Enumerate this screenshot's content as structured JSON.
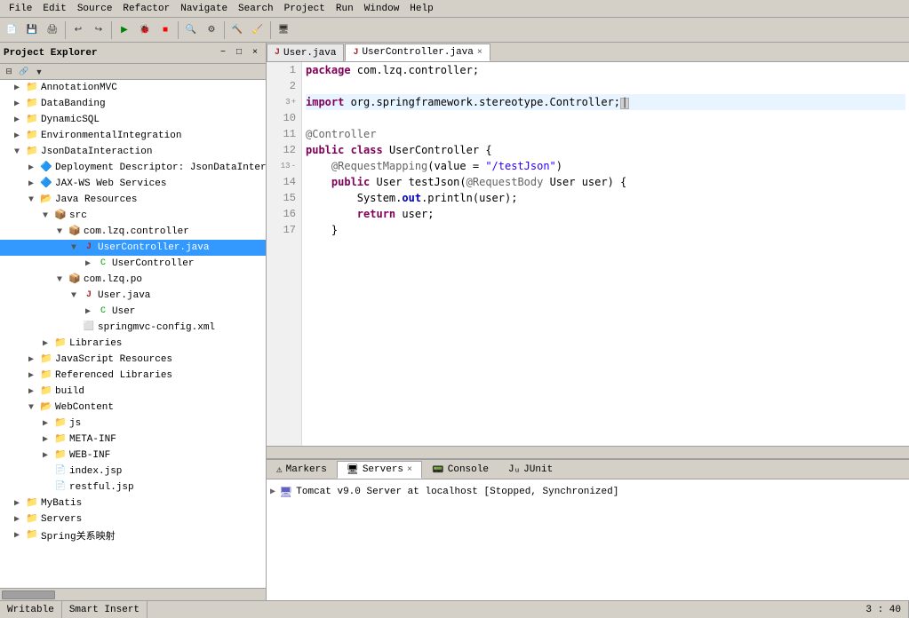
{
  "menubar": {
    "items": [
      "File",
      "Edit",
      "Source",
      "Refactor",
      "Navigate",
      "Search",
      "Project",
      "Run",
      "Window",
      "Help"
    ]
  },
  "panels": {
    "left": {
      "title": "Project Explorer",
      "close_icon": "×",
      "tree": [
        {
          "id": "annotationmvc",
          "label": "AnnotationMVC",
          "level": 0,
          "type": "project",
          "expanded": false,
          "icon": "📁"
        },
        {
          "id": "databanding",
          "label": "DataBanding",
          "level": 0,
          "type": "project",
          "expanded": false,
          "icon": "📁"
        },
        {
          "id": "dynamicsql",
          "label": "DynamicSQL",
          "level": 0,
          "type": "project",
          "expanded": false,
          "icon": "📁"
        },
        {
          "id": "environmentalintegration",
          "label": "EnvironmentalIntegration",
          "level": 0,
          "type": "project",
          "expanded": false,
          "icon": "📁"
        },
        {
          "id": "jsondatainteraction",
          "label": "JsonDataInteraction",
          "level": 0,
          "type": "project",
          "expanded": true,
          "icon": "📁"
        },
        {
          "id": "deployment",
          "label": "Deployment Descriptor: JsonDataIntera...",
          "level": 1,
          "type": "deploy",
          "expanded": false,
          "icon": "🔷"
        },
        {
          "id": "jaxws",
          "label": "JAX-WS Web Services",
          "level": 1,
          "type": "service",
          "expanded": false,
          "icon": "🔷"
        },
        {
          "id": "javaresources",
          "label": "Java Resources",
          "level": 1,
          "type": "folder",
          "expanded": true,
          "icon": "📂"
        },
        {
          "id": "src",
          "label": "src",
          "level": 2,
          "type": "src",
          "expanded": true,
          "icon": "📦"
        },
        {
          "id": "comlzqcontroller",
          "label": "com.lzq.controller",
          "level": 3,
          "type": "package",
          "expanded": true,
          "icon": "📦"
        },
        {
          "id": "usercontroller_java",
          "label": "UserController.java",
          "level": 4,
          "type": "java",
          "expanded": true,
          "icon": "J",
          "selected": true
        },
        {
          "id": "usercontroller_class",
          "label": "UserController",
          "level": 5,
          "type": "class",
          "expanded": false,
          "icon": "C"
        },
        {
          "id": "comlzqpo",
          "label": "com.lzq.po",
          "level": 3,
          "type": "package",
          "expanded": true,
          "icon": "📦"
        },
        {
          "id": "user_java",
          "label": "User.java",
          "level": 4,
          "type": "java",
          "expanded": true,
          "icon": "J"
        },
        {
          "id": "user_class",
          "label": "User",
          "level": 5,
          "type": "class",
          "expanded": false,
          "icon": "C"
        },
        {
          "id": "springmvc_config",
          "label": "springmvc-config.xml",
          "level": 3,
          "type": "xml",
          "icon": "X"
        },
        {
          "id": "libraries",
          "label": "Libraries",
          "level": 2,
          "type": "folder",
          "expanded": false,
          "icon": "📁"
        },
        {
          "id": "javascript_resources",
          "label": "JavaScript Resources",
          "level": 1,
          "type": "folder",
          "expanded": false,
          "icon": "📁"
        },
        {
          "id": "referenced_libraries",
          "label": "Referenced Libraries",
          "level": 1,
          "type": "folder",
          "expanded": false,
          "icon": "📁"
        },
        {
          "id": "build",
          "label": "build",
          "level": 1,
          "type": "folder",
          "expanded": false,
          "icon": "📁"
        },
        {
          "id": "webcontent",
          "label": "WebContent",
          "level": 1,
          "type": "folder",
          "expanded": true,
          "icon": "📂"
        },
        {
          "id": "js",
          "label": "js",
          "level": 2,
          "type": "folder",
          "expanded": false,
          "icon": "📁"
        },
        {
          "id": "meta_inf",
          "label": "META-INF",
          "level": 2,
          "type": "folder",
          "expanded": false,
          "icon": "📁"
        },
        {
          "id": "web_inf",
          "label": "WEB-INF",
          "level": 2,
          "type": "folder",
          "expanded": false,
          "icon": "📁"
        },
        {
          "id": "index_jsp",
          "label": "index.jsp",
          "level": 2,
          "type": "jsp",
          "icon": "📄"
        },
        {
          "id": "restful_jsp",
          "label": "restful.jsp",
          "level": 2,
          "type": "jsp",
          "icon": "📄"
        },
        {
          "id": "mybatis",
          "label": "MyBatis",
          "level": 0,
          "type": "project",
          "expanded": false,
          "icon": "📁"
        },
        {
          "id": "servers",
          "label": "Servers",
          "level": 0,
          "type": "project",
          "expanded": false,
          "icon": "📁"
        },
        {
          "id": "spring_mapping",
          "label": "Spring关系映射",
          "level": 0,
          "type": "project",
          "expanded": false,
          "icon": "📁"
        }
      ]
    },
    "editor": {
      "tabs": [
        {
          "id": "user_java",
          "label": "User.java",
          "active": false,
          "closable": false
        },
        {
          "id": "usercontroller_java",
          "label": "UserController.java",
          "active": true,
          "closable": true
        }
      ],
      "lines": [
        {
          "num": 1,
          "content": "package com.lzq.controller;",
          "tokens": [
            {
              "text": "package",
              "class": "kw"
            },
            {
              "text": " com.lzq.controller;",
              "class": ""
            }
          ]
        },
        {
          "num": 2,
          "content": "",
          "tokens": []
        },
        {
          "num": 3,
          "content": "import org.springframework.stereotype.Controller;",
          "tokens": [
            {
              "text": "import",
              "class": "kw"
            },
            {
              "text": " org.springframework.stereotype.Controller;",
              "class": ""
            }
          ],
          "has_fold": true
        },
        {
          "num": 10,
          "content": "",
          "tokens": []
        },
        {
          "num": 11,
          "content": "@Controller",
          "tokens": [
            {
              "text": "@Controller",
              "class": "annotation"
            }
          ]
        },
        {
          "num": 12,
          "content": "public class UserController {",
          "tokens": [
            {
              "text": "public",
              "class": "kw"
            },
            {
              "text": " ",
              "class": ""
            },
            {
              "text": "class",
              "class": "kw"
            },
            {
              "text": " UserController {",
              "class": ""
            }
          ]
        },
        {
          "num": 13,
          "content": "    @RequestMapping(value = \"/testJson\")",
          "tokens": [
            {
              "text": "    ",
              "class": ""
            },
            {
              "text": "@RequestMapping",
              "class": "annotation"
            },
            {
              "text": "(value = ",
              "class": ""
            },
            {
              "text": "\"/testJson\"",
              "class": "string"
            },
            {
              "text": ")",
              "class": ""
            }
          ],
          "has_fold": true
        },
        {
          "num": 14,
          "content": "    public User testJson(@RequestBody User user) {",
          "tokens": [
            {
              "text": "    ",
              "class": ""
            },
            {
              "text": "public",
              "class": "kw"
            },
            {
              "text": " User testJson(",
              "class": ""
            },
            {
              "text": "@RequestBody",
              "class": "annotation"
            },
            {
              "text": " User user) {",
              "class": ""
            }
          ]
        },
        {
          "num": 15,
          "content": "        System.out.println(user);",
          "tokens": [
            {
              "text": "        System.",
              "class": ""
            },
            {
              "text": "out",
              "class": "kw2"
            },
            {
              "text": ".println(user);",
              "class": ""
            }
          ]
        },
        {
          "num": 16,
          "content": "        return user;",
          "tokens": [
            {
              "text": "        ",
              "class": ""
            },
            {
              "text": "return",
              "class": "kw"
            },
            {
              "text": " user;",
              "class": ""
            }
          ]
        },
        {
          "num": 17,
          "content": "    }",
          "tokens": [
            {
              "text": "    }",
              "class": ""
            }
          ]
        }
      ]
    },
    "bottom": {
      "tabs": [
        {
          "id": "markers",
          "label": "Markers",
          "active": false,
          "icon": "⚠"
        },
        {
          "id": "servers",
          "label": "Servers",
          "active": true,
          "icon": "🖥"
        },
        {
          "id": "console",
          "label": "Console",
          "active": false,
          "icon": "📟"
        },
        {
          "id": "junit",
          "label": "JUnit",
          "active": false,
          "icon": "✓"
        }
      ],
      "server_entry": {
        "label": "Tomcat v9.0 Server at localhost  [Stopped, Synchronized]",
        "status": "Stopped, Synchronized"
      }
    }
  },
  "statusbar": {
    "writable": "Writable",
    "insert": "Smart Insert",
    "position": "3 : 40"
  }
}
